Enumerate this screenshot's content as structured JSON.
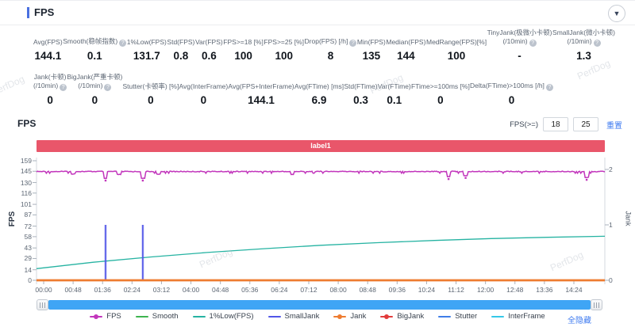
{
  "panel": {
    "title": "FPS",
    "collapse_icon": "▼"
  },
  "icons": {
    "help": "?"
  },
  "watermark": "PerfDog",
  "stats_row1": [
    {
      "label": "Avg(FPS)",
      "value": "144.1"
    },
    {
      "label": "Smooth(稳帧指数)",
      "help": true,
      "value": "0.1"
    },
    {
      "label": "1%Low(FPS)",
      "value": "131.7"
    },
    {
      "label": "Std(FPS)",
      "value": "0.8"
    },
    {
      "label": "Var(FPS)",
      "value": "0.6"
    },
    {
      "label": "FPS>=18 [%]",
      "value": "100"
    },
    {
      "label": "FPS>=25 [%]",
      "value": "100"
    },
    {
      "label": "Drop(FPS) [/h]",
      "help": true,
      "value": "8"
    },
    {
      "label": "Min(FPS)",
      "value": "135"
    },
    {
      "label": "Median(FPS)",
      "value": "144"
    },
    {
      "label": "MedRange(FPS)[%]",
      "value": "100"
    },
    {
      "label": "TinyJank(极微小卡顿)",
      "label2": "(/10min)",
      "help": true,
      "value": "-"
    },
    {
      "label": "SmallJank(微小卡顿)",
      "label2": "(/10min)",
      "help": true,
      "value": "1.3"
    }
  ],
  "stats_row2": [
    {
      "label": "Jank(卡顿)",
      "label2": "(/10min)",
      "help": true,
      "value": "0"
    },
    {
      "label": "BigJank(严重卡顿)",
      "label2": "(/10min)",
      "help": true,
      "value": "0"
    },
    {
      "label": "Stutter(卡顿率) [%]",
      "value": "0"
    },
    {
      "label": "Avg(InterFrame)",
      "value": "0"
    },
    {
      "label": "Avg(FPS+InterFrame)",
      "value": "144.1"
    },
    {
      "label": "Avg(FTime) [ms]",
      "value": "6.9"
    },
    {
      "label": "Std(FTime)",
      "value": "0.3"
    },
    {
      "label": "Var(FTime)",
      "value": "0.1"
    },
    {
      "label": "FTime>=100ms [%]",
      "value": "0"
    },
    {
      "label": "Delta(FTime)>100ms [/h]",
      "help": true,
      "value": "0"
    }
  ],
  "chart_section": {
    "title": "FPS",
    "threshold_label": "FPS(>=)",
    "threshold_values": [
      "18",
      "25"
    ],
    "reset_label": "重置",
    "banner_label": "label1",
    "hide_all_label": "全隐藏"
  },
  "chart_data": {
    "type": "line",
    "title": "FPS",
    "banner_annotation": "label1",
    "x_ticks": [
      "00:00",
      "00:48",
      "01:36",
      "02:24",
      "03:12",
      "04:00",
      "04:48",
      "05:36",
      "06:24",
      "07:12",
      "08:00",
      "08:48",
      "09:36",
      "10:24",
      "11:12",
      "12:00",
      "12:48",
      "13:36",
      "14:24"
    ],
    "y_left": {
      "label": "FPS",
      "range": [
        0,
        159
      ],
      "ticks": [
        0,
        14,
        29,
        43,
        58,
        72,
        87,
        101,
        116,
        130,
        145,
        159
      ]
    },
    "y_right": {
      "label": "Jank",
      "range": [
        0,
        2
      ],
      "ticks": [
        0,
        1,
        2
      ]
    },
    "grid": false,
    "legend_position": "bottom",
    "series": [
      {
        "name": "Stutter",
        "color": "#3f7de8",
        "axis": "left",
        "type": "flat",
        "value": 0
      },
      {
        "name": "InterFrame",
        "color": "#35c8e8",
        "axis": "left",
        "type": "flat",
        "value": 0
      },
      {
        "name": "BigJank",
        "color": "#e23c3c",
        "axis": "right",
        "type": "flat",
        "value": 0
      },
      {
        "name": "Smooth",
        "color": "#3eb44f",
        "axis": "left",
        "type": "flat",
        "value": 0.1
      },
      {
        "name": "1%Low(FPS)",
        "color": "#26b3a2",
        "axis": "left",
        "type": "curve",
        "points": [
          [
            0,
            15.5
          ],
          [
            0.1,
            24
          ],
          [
            0.2,
            31
          ],
          [
            0.3,
            37
          ],
          [
            0.4,
            42
          ],
          [
            0.5,
            46.5
          ],
          [
            0.6,
            50
          ],
          [
            0.7,
            53
          ],
          [
            0.8,
            55.5
          ],
          [
            0.9,
            57.2
          ],
          [
            1,
            58.5
          ]
        ]
      },
      {
        "name": "SmallJank",
        "color": "#5156e8",
        "axis": "right",
        "type": "spikes",
        "events": [
          [
            0.1215,
            1
          ],
          [
            0.187,
            1
          ]
        ]
      },
      {
        "name": "Jank",
        "color": "#ee7c30",
        "axis": "right",
        "type": "flat",
        "value": 0
      },
      {
        "name": "FPS",
        "color": "#c236bc",
        "axis": "left",
        "type": "noisy-line",
        "baseline": 145,
        "dips": [
          [
            0.065,
            141
          ],
          [
            0.1215,
            135.5
          ],
          [
            0.145,
            140.5
          ],
          [
            0.187,
            135.5
          ],
          [
            0.215,
            141
          ],
          [
            0.45,
            140.5
          ],
          [
            0.725,
            137.5
          ],
          [
            0.755,
            139
          ],
          [
            0.968,
            136.5
          ]
        ]
      }
    ],
    "legend": [
      {
        "name": "FPS",
        "color": "#c236bc",
        "marker": "dot"
      },
      {
        "name": "Smooth",
        "color": "#3eb44f",
        "marker": "plain"
      },
      {
        "name": "1%Low(FPS)",
        "color": "#26b3a2",
        "marker": "plain"
      },
      {
        "name": "SmallJank",
        "color": "#5156e8",
        "marker": "plain"
      },
      {
        "name": "Jank",
        "color": "#ee7c30",
        "marker": "dot"
      },
      {
        "name": "BigJank",
        "color": "#e23c3c",
        "marker": "dot"
      },
      {
        "name": "Stutter",
        "color": "#3f7de8",
        "marker": "plain"
      },
      {
        "name": "InterFrame",
        "color": "#35c8e8",
        "marker": "plain"
      }
    ]
  }
}
